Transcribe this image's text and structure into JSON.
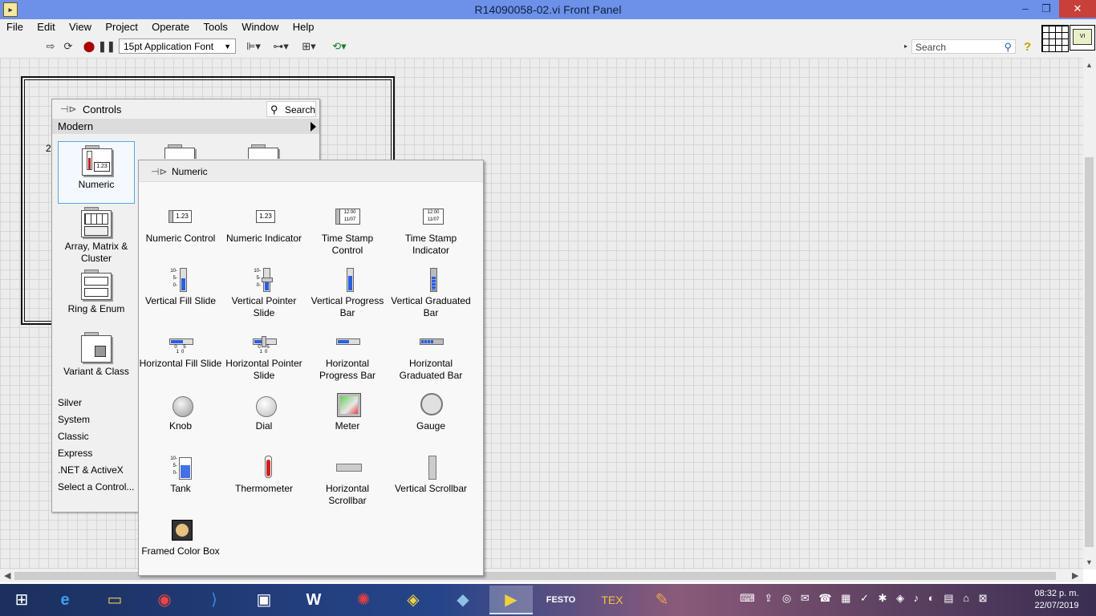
{
  "window": {
    "title": "R14090058-02.vi Front Panel",
    "minimize": "–",
    "maximize": "❐",
    "close": "✕"
  },
  "menu": [
    "File",
    "Edit",
    "View",
    "Project",
    "Operate",
    "Tools",
    "Window",
    "Help"
  ],
  "toolbar": {
    "font": "15pt Application Font",
    "search_placeholder": "Search",
    "help": "?"
  },
  "frame": {
    "label": "2"
  },
  "controls_palette": {
    "title": "Controls",
    "search_label": "Search",
    "section": "Modern",
    "categories": [
      {
        "label": "Numeric",
        "selected": true
      },
      {
        "label": "Array, Matrix & Cluster"
      },
      {
        "label": "Ring & Enum"
      },
      {
        "label": "Variant & Class"
      }
    ],
    "other_sections": [
      "Silver",
      "System",
      "Classic",
      "Express",
      ".NET & ActiveX",
      "Select a Control..."
    ]
  },
  "numeric_palette": {
    "title": "Numeric",
    "items": [
      "Numeric Control",
      "Numeric Indicator",
      "Time Stamp Control",
      "Time Stamp Indicator",
      "Vertical Fill Slide",
      "Vertical Pointer Slide",
      "Vertical Progress Bar",
      "Vertical Graduated Bar",
      "Horizontal Fill Slide",
      "Horizontal Pointer Slide",
      "Horizontal Progress Bar",
      "Horizontal Graduated Bar",
      "Knob",
      "Dial",
      "Meter",
      "Gauge",
      "Tank",
      "Thermometer",
      "Horizontal Scrollbar",
      "Vertical Scrollbar",
      "Framed Color Box"
    ],
    "icon_text": {
      "numeric": "1.23",
      "timestamp": "12:00 11/07",
      "scale_v": "10- 5- 0-",
      "scale_h": "0 5 10"
    }
  },
  "taskbar": {
    "clock_time": "08:32 p. m.",
    "clock_date": "22/07/2019",
    "icons": [
      "windows-start",
      "internet-explorer",
      "file-explorer",
      "chrome",
      "vscode",
      "task-view",
      "word",
      "spider-app",
      "dark-app",
      "notes-app",
      "labview",
      "festo-fluidsim",
      "tex",
      "paint"
    ]
  }
}
